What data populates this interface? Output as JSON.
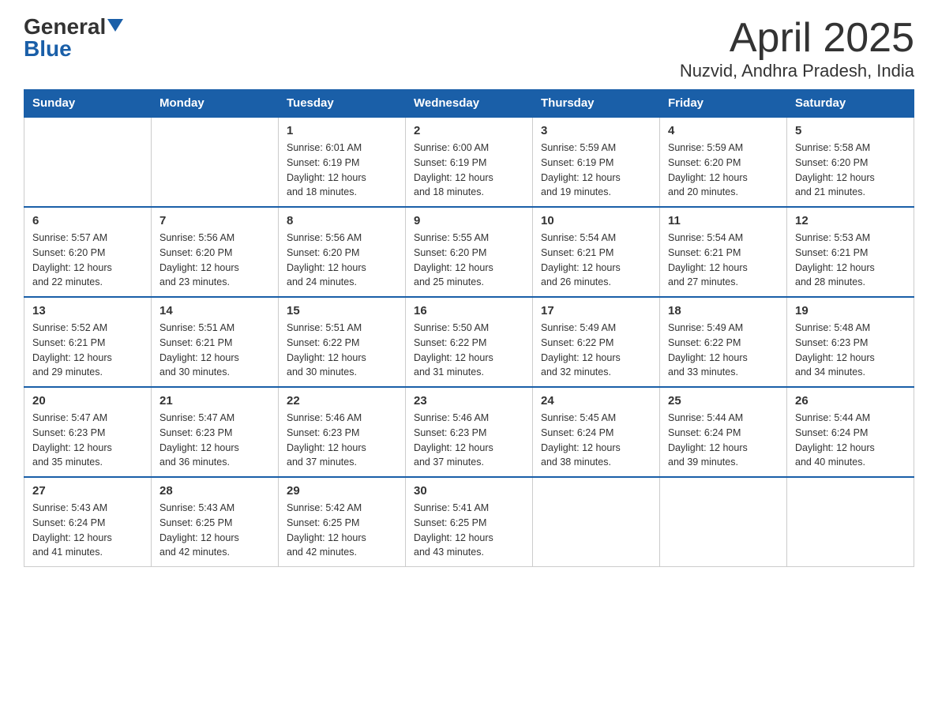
{
  "header": {
    "logo_general": "General",
    "logo_blue": "Blue",
    "month_title": "April 2025",
    "location": "Nuzvid, Andhra Pradesh, India"
  },
  "weekdays": [
    "Sunday",
    "Monday",
    "Tuesday",
    "Wednesday",
    "Thursday",
    "Friday",
    "Saturday"
  ],
  "weeks": [
    [
      {
        "day": "",
        "info": ""
      },
      {
        "day": "",
        "info": ""
      },
      {
        "day": "1",
        "info": "Sunrise: 6:01 AM\nSunset: 6:19 PM\nDaylight: 12 hours\nand 18 minutes."
      },
      {
        "day": "2",
        "info": "Sunrise: 6:00 AM\nSunset: 6:19 PM\nDaylight: 12 hours\nand 18 minutes."
      },
      {
        "day": "3",
        "info": "Sunrise: 5:59 AM\nSunset: 6:19 PM\nDaylight: 12 hours\nand 19 minutes."
      },
      {
        "day": "4",
        "info": "Sunrise: 5:59 AM\nSunset: 6:20 PM\nDaylight: 12 hours\nand 20 minutes."
      },
      {
        "day": "5",
        "info": "Sunrise: 5:58 AM\nSunset: 6:20 PM\nDaylight: 12 hours\nand 21 minutes."
      }
    ],
    [
      {
        "day": "6",
        "info": "Sunrise: 5:57 AM\nSunset: 6:20 PM\nDaylight: 12 hours\nand 22 minutes."
      },
      {
        "day": "7",
        "info": "Sunrise: 5:56 AM\nSunset: 6:20 PM\nDaylight: 12 hours\nand 23 minutes."
      },
      {
        "day": "8",
        "info": "Sunrise: 5:56 AM\nSunset: 6:20 PM\nDaylight: 12 hours\nand 24 minutes."
      },
      {
        "day": "9",
        "info": "Sunrise: 5:55 AM\nSunset: 6:20 PM\nDaylight: 12 hours\nand 25 minutes."
      },
      {
        "day": "10",
        "info": "Sunrise: 5:54 AM\nSunset: 6:21 PM\nDaylight: 12 hours\nand 26 minutes."
      },
      {
        "day": "11",
        "info": "Sunrise: 5:54 AM\nSunset: 6:21 PM\nDaylight: 12 hours\nand 27 minutes."
      },
      {
        "day": "12",
        "info": "Sunrise: 5:53 AM\nSunset: 6:21 PM\nDaylight: 12 hours\nand 28 minutes."
      }
    ],
    [
      {
        "day": "13",
        "info": "Sunrise: 5:52 AM\nSunset: 6:21 PM\nDaylight: 12 hours\nand 29 minutes."
      },
      {
        "day": "14",
        "info": "Sunrise: 5:51 AM\nSunset: 6:21 PM\nDaylight: 12 hours\nand 30 minutes."
      },
      {
        "day": "15",
        "info": "Sunrise: 5:51 AM\nSunset: 6:22 PM\nDaylight: 12 hours\nand 30 minutes."
      },
      {
        "day": "16",
        "info": "Sunrise: 5:50 AM\nSunset: 6:22 PM\nDaylight: 12 hours\nand 31 minutes."
      },
      {
        "day": "17",
        "info": "Sunrise: 5:49 AM\nSunset: 6:22 PM\nDaylight: 12 hours\nand 32 minutes."
      },
      {
        "day": "18",
        "info": "Sunrise: 5:49 AM\nSunset: 6:22 PM\nDaylight: 12 hours\nand 33 minutes."
      },
      {
        "day": "19",
        "info": "Sunrise: 5:48 AM\nSunset: 6:23 PM\nDaylight: 12 hours\nand 34 minutes."
      }
    ],
    [
      {
        "day": "20",
        "info": "Sunrise: 5:47 AM\nSunset: 6:23 PM\nDaylight: 12 hours\nand 35 minutes."
      },
      {
        "day": "21",
        "info": "Sunrise: 5:47 AM\nSunset: 6:23 PM\nDaylight: 12 hours\nand 36 minutes."
      },
      {
        "day": "22",
        "info": "Sunrise: 5:46 AM\nSunset: 6:23 PM\nDaylight: 12 hours\nand 37 minutes."
      },
      {
        "day": "23",
        "info": "Sunrise: 5:46 AM\nSunset: 6:23 PM\nDaylight: 12 hours\nand 37 minutes."
      },
      {
        "day": "24",
        "info": "Sunrise: 5:45 AM\nSunset: 6:24 PM\nDaylight: 12 hours\nand 38 minutes."
      },
      {
        "day": "25",
        "info": "Sunrise: 5:44 AM\nSunset: 6:24 PM\nDaylight: 12 hours\nand 39 minutes."
      },
      {
        "day": "26",
        "info": "Sunrise: 5:44 AM\nSunset: 6:24 PM\nDaylight: 12 hours\nand 40 minutes."
      }
    ],
    [
      {
        "day": "27",
        "info": "Sunrise: 5:43 AM\nSunset: 6:24 PM\nDaylight: 12 hours\nand 41 minutes."
      },
      {
        "day": "28",
        "info": "Sunrise: 5:43 AM\nSunset: 6:25 PM\nDaylight: 12 hours\nand 42 minutes."
      },
      {
        "day": "29",
        "info": "Sunrise: 5:42 AM\nSunset: 6:25 PM\nDaylight: 12 hours\nand 42 minutes."
      },
      {
        "day": "30",
        "info": "Sunrise: 5:41 AM\nSunset: 6:25 PM\nDaylight: 12 hours\nand 43 minutes."
      },
      {
        "day": "",
        "info": ""
      },
      {
        "day": "",
        "info": ""
      },
      {
        "day": "",
        "info": ""
      }
    ]
  ]
}
